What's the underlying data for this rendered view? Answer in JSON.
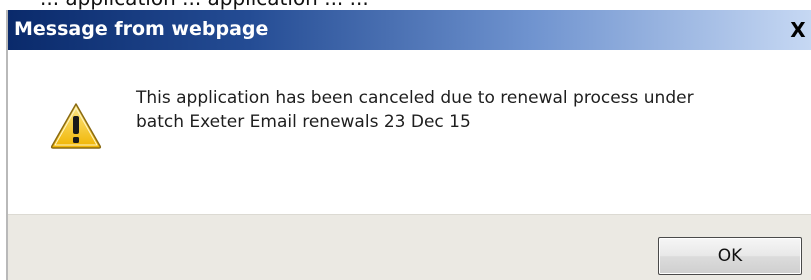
{
  "top_caption": "... application ... application ... ...",
  "dialog": {
    "title": "Message from webpage",
    "close_label": "X",
    "icon": "warning-icon",
    "message_lines": [
      "This application has been canceled due to renewal process under",
      "batch Exeter Email renewals 23 Dec 15"
    ],
    "ok_label": "OK"
  },
  "colors": {
    "titlebar_start": "#0a2a6b",
    "titlebar_end": "#c6d8f3",
    "footer_bg": "#ebe9e3",
    "warning_yellow": "#f5c518"
  }
}
